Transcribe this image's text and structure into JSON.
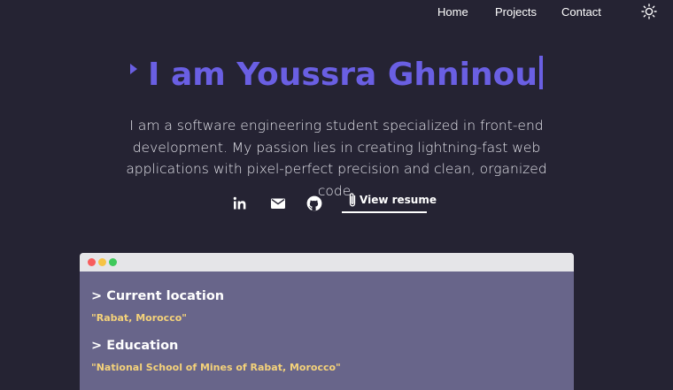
{
  "nav": {
    "home": "Home",
    "projects": "Projects",
    "contact": "Contact",
    "theme_icon": "sun-icon"
  },
  "hero": {
    "title": "I am Youssra Ghninou",
    "accent_color": "#6a5fe3",
    "bio": "I am a software engineering student specialized in front-end development. My passion lies in creating lightning-fast web applications with pixel-perfect precision and clean, organized code."
  },
  "links": {
    "icons": [
      "linkedin-icon",
      "mail-icon",
      "github-icon",
      "paperclip-icon"
    ],
    "resume_label": "View resume"
  },
  "card": {
    "window_dots": [
      "#f75d5d",
      "#f6c344",
      "#3fc95b"
    ],
    "sections": [
      {
        "title": "> Current location",
        "value": "\"Rabat, Morocco\""
      },
      {
        "title": "> Education",
        "value": "\"National School of Mines of Rabat, Morocco\""
      }
    ]
  }
}
